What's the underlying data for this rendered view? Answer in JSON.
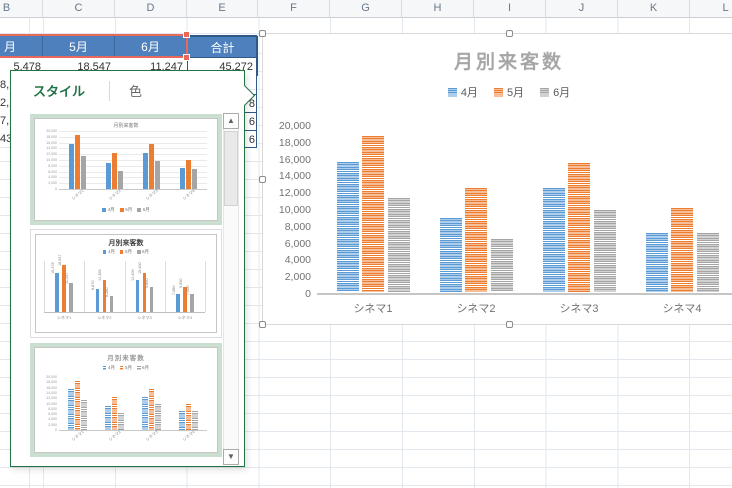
{
  "columns": [
    "B",
    "C",
    "D",
    "E",
    "F",
    "G",
    "H",
    "I",
    "J",
    "K",
    "L"
  ],
  "table": {
    "months_header": [
      "月",
      "5月",
      "6月",
      "合計"
    ],
    "values_row": [
      "5,478",
      "18,547",
      "11,247",
      "45,272"
    ],
    "left_partials": [
      "8,",
      "2,",
      "7,",
      "43,"
    ],
    "right_partials": [
      "8",
      "6",
      "6"
    ]
  },
  "panel": {
    "tabs": [
      {
        "label": "スタイル",
        "active": true
      },
      {
        "label": "色",
        "active": false
      }
    ],
    "scrollbar": {
      "up_icon": "▲",
      "down_icon": "▼"
    }
  },
  "chart_data": {
    "type": "bar",
    "title": "月別来客数",
    "categories": [
      "シネマ1",
      "シネマ2",
      "シネマ3",
      "シネマ4"
    ],
    "series": [
      {
        "name": "4月",
        "color": "#5B9BD5",
        "values": [
          15478,
          8870,
          12400,
          7080
        ]
      },
      {
        "name": "5月",
        "color": "#ED7D31",
        "values": [
          18547,
          12365,
          15400,
          9950
        ]
      },
      {
        "name": "6月",
        "color": "#A5A5A5",
        "values": [
          11247,
          6280,
          9800,
          7000
        ]
      }
    ],
    "ylim": [
      0,
      20000
    ],
    "ytick_step": 2000,
    "ytick_labels": [
      "0",
      "2,000",
      "4,000",
      "6,000",
      "8,000",
      "10,000",
      "12,000",
      "14,000",
      "16,000",
      "18,000",
      "20,000"
    ],
    "gridlines": false,
    "legend_position": "top",
    "bar_fill": "horizontal-stripes"
  },
  "colors": {
    "header_fill": "#4E80BD",
    "excel_green": "#217346",
    "selection_red": "#E8695A",
    "range_blue": "#2E5A87",
    "series_blue": "#5B9BD5",
    "series_orange": "#ED7D31",
    "series_gray": "#A5A5A5"
  }
}
